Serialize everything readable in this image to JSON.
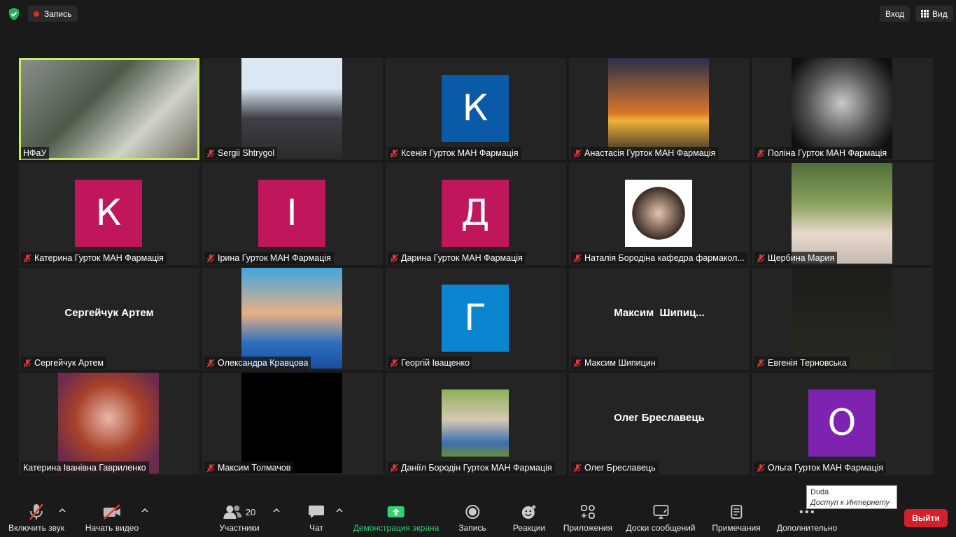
{
  "topbar": {
    "record_label": "Запись",
    "enter_label": "Вход",
    "view_label": "Вид"
  },
  "participants": [
    {
      "name": "НФаУ",
      "type": "video",
      "active": true,
      "muted": false
    },
    {
      "name": "Sergii Shtrygol",
      "type": "photo",
      "muted": true
    },
    {
      "name": "Ксенія Гурток МАН Фармація",
      "type": "avatar",
      "initial": "К",
      "color": "#0a5aa8",
      "muted": true
    },
    {
      "name": "Анастасія Гурток МАН Фармація",
      "type": "photo",
      "muted": true
    },
    {
      "name": "Поліна Гурток МАН Фармація",
      "type": "photo",
      "muted": true
    },
    {
      "name": "Катерина Гурток МАН Фармація",
      "type": "avatar",
      "initial": "К",
      "color": "#c0175c",
      "muted": true
    },
    {
      "name": "Ірина Гурток МАН Фармація",
      "type": "avatar",
      "initial": "І",
      "color": "#c0175c",
      "muted": true
    },
    {
      "name": "Дарина Гурток МАН Фармація",
      "type": "avatar",
      "initial": "Д",
      "color": "#c0175c",
      "muted": true
    },
    {
      "name": "Наталія Бородіна кафедра фармакол...",
      "type": "photo",
      "muted": true
    },
    {
      "name": "Щербина Мария",
      "type": "photo",
      "muted": true
    },
    {
      "name": "Сергейчук Артем",
      "type": "text",
      "bigname": "Сергейчук Артем",
      "muted": true
    },
    {
      "name": "Олександра Кравцова",
      "type": "photo",
      "muted": true
    },
    {
      "name": "Георгій Іващенко",
      "type": "avatar",
      "initial": "Г",
      "color": "#0a85d0",
      "muted": true
    },
    {
      "name": "Максим Шипицин",
      "type": "text",
      "bigname": "Максим  Шипиц...",
      "muted": true
    },
    {
      "name": "Евгенія Терновська",
      "type": "photo",
      "muted": true
    },
    {
      "name": "Катерина Іванівна Гавриленко",
      "type": "photo",
      "muted": false
    },
    {
      "name": "Максим Толмачов",
      "type": "photo",
      "muted": true
    },
    {
      "name": "Даніїл Бородін Гурток МАН Фармація",
      "type": "photo",
      "muted": true
    },
    {
      "name": "Олег Бреславець",
      "type": "text",
      "bigname": "Олег Бреславець",
      "muted": true
    },
    {
      "name": "Ольга Гурток МАН Фармація",
      "type": "avatar",
      "initial": "О",
      "color": "#7e22b0",
      "muted": true
    }
  ],
  "toolbar": {
    "unmute_label": "Включить звук",
    "start_video_label": "Начать видео",
    "participants_label": "Участники",
    "participants_count": "20",
    "chat_label": "Чат",
    "share_label": "Демонстрация экрана",
    "record_label": "Запись",
    "reactions_label": "Реакции",
    "apps_label": "Приложения",
    "whiteboards_label": "Доски сообщений",
    "notes_label": "Примечания",
    "more_label": "Дополнительно",
    "leave_label": "Выйти"
  },
  "tooltip": {
    "title": "Duda",
    "subtitle": "Доступ к Интернету"
  },
  "colors": {
    "active_speaker": "#c8ee5a",
    "leave": "#d0212c",
    "share": "#2dd36f",
    "muted_icon": "#e0383e"
  }
}
